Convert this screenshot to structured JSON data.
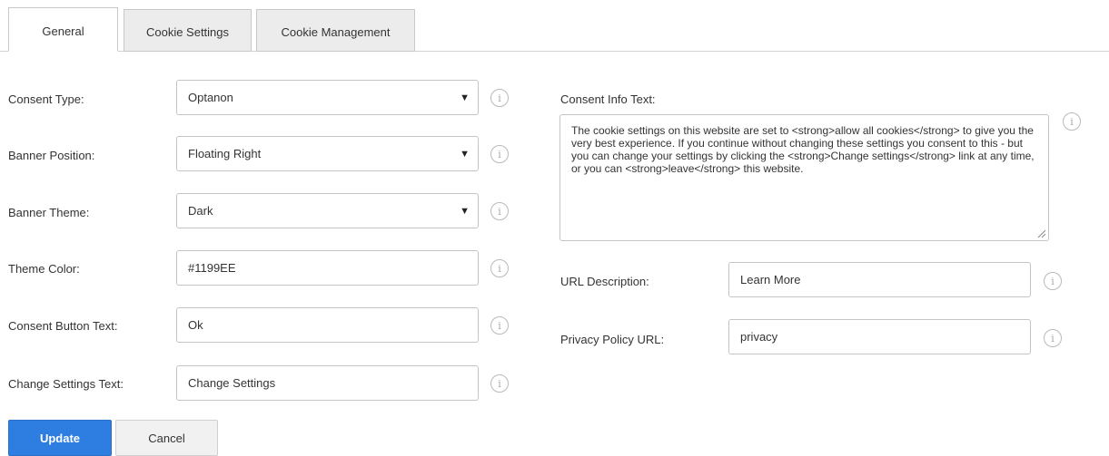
{
  "tabs": [
    {
      "label": "General",
      "active": true
    },
    {
      "label": "Cookie Settings",
      "active": false
    },
    {
      "label": "Cookie Management",
      "active": false
    }
  ],
  "form": {
    "consent_type": {
      "label": "Consent Type:",
      "value": "Optanon"
    },
    "banner_position": {
      "label": "Banner Position:",
      "value": "Floating Right"
    },
    "banner_theme": {
      "label": "Banner Theme:",
      "value": "Dark"
    },
    "theme_color": {
      "label": "Theme Color:",
      "value": "#1199EE"
    },
    "consent_button_text": {
      "label": "Consent Button Text:",
      "value": "Ok"
    },
    "change_settings_text": {
      "label": "Change Settings Text:",
      "value": "Change Settings"
    },
    "consent_info_text": {
      "label": "Consent Info Text:",
      "value": "The cookie settings on this website are set to <strong>allow all cookies</strong> to give you the very best experience. If you continue without changing these settings you consent to this - but you can change your settings by clicking the <strong>Change settings</strong> link at any time, or you can <strong>leave</strong> this website."
    },
    "url_description": {
      "label": "URL Description:",
      "value": "Learn More"
    },
    "privacy_policy_url": {
      "label": "Privacy Policy URL:",
      "value": "privacy"
    }
  },
  "icons": {
    "info": "i",
    "select_arrow": "▼"
  },
  "buttons": {
    "update_label": "Update",
    "cancel_label": "Cancel"
  },
  "colors": {
    "primary_button": "#2e7de1"
  }
}
